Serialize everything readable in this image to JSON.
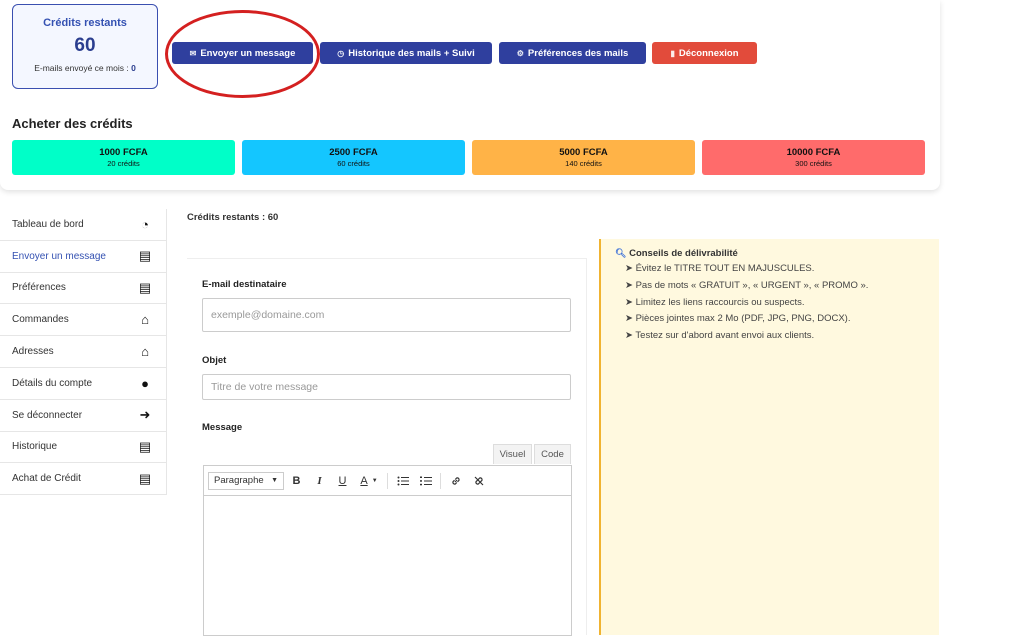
{
  "summary": {
    "title": "Crédits restants",
    "count": "60",
    "sent_label": "E-mails envoyé ce mois :",
    "sent_count": "0"
  },
  "actions": [
    {
      "icon": "✉",
      "label": "Envoyer un message"
    },
    {
      "icon": "◷",
      "label": "Historique des mails + Suivi"
    },
    {
      "icon": "⚙",
      "label": "Préférences des mails"
    },
    {
      "icon": "▮",
      "label": "Déconnexion"
    }
  ],
  "buy": {
    "title": "Acheter des crédits",
    "packs": [
      {
        "price": "1000 FCFA",
        "credits": "20 crédits",
        "color": "#00ffc8"
      },
      {
        "price": "2500 FCFA",
        "credits": "60 crédits",
        "color": "#14c6ff"
      },
      {
        "price": "5000 FCFA",
        "credits": "140 crédits",
        "color": "#ffb347"
      },
      {
        "price": "10000 FCFA",
        "credits": "300 crédits",
        "color": "#ff6b6b"
      }
    ]
  },
  "sidebar": {
    "items": [
      {
        "label": "Tableau de bord",
        "icon": "◔"
      },
      {
        "label": "Envoyer un message",
        "icon": "▤"
      },
      {
        "label": "Préférences",
        "icon": "▤"
      },
      {
        "label": "Commandes",
        "icon": "⌂"
      },
      {
        "label": "Adresses",
        "icon": "⌂"
      },
      {
        "label": "Détails du compte",
        "icon": "●"
      },
      {
        "label": "Se déconnecter",
        "icon": "➜"
      },
      {
        "label": "Historique",
        "icon": "▤"
      },
      {
        "label": "Achat de Crédit",
        "icon": "▤"
      }
    ]
  },
  "main": {
    "credits_line": "Crédits restants : 60"
  },
  "form": {
    "to_label": "E-mail destinataire",
    "to_placeholder": "exemple@domaine.com",
    "subject_label": "Objet",
    "subject_placeholder": "Titre de votre message",
    "message_label": "Message",
    "tab_visual": "Visuel",
    "tab_code": "Code",
    "format_select": "Paragraphe"
  },
  "tips": {
    "title": "Conseils de délivrabilité",
    "items": [
      "➤ Évitez le TITRE TOUT EN MAJUSCULES.",
      "➤ Pas de mots « GRATUIT », « URGENT », « PROMO ».",
      "➤ Limitez les liens raccourcis ou suspects.",
      "➤ Pièces jointes max 2 Mo (PDF, JPG, PNG, DOCX).",
      "➤ Testez sur d'abord avant envoi aux clients."
    ]
  }
}
